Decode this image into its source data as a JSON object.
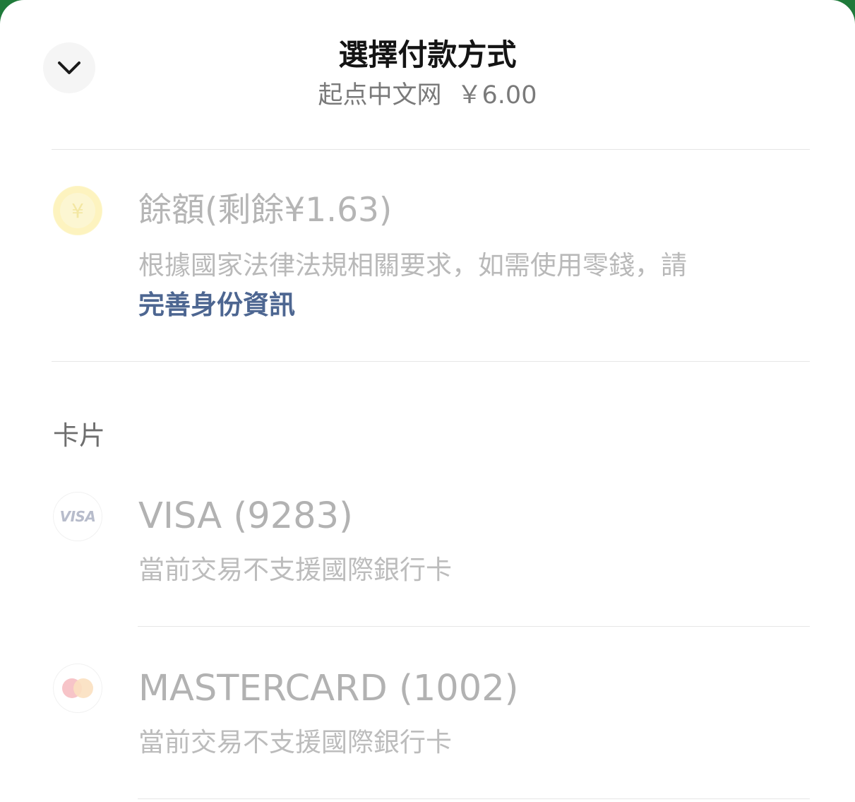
{
  "header": {
    "title": "選擇付款方式",
    "merchant": "起点中文网",
    "amount": "￥6.00",
    "collapse_icon": "chevron-down-icon"
  },
  "balance": {
    "icon": "yuan-coin-icon",
    "icon_glyph": "¥",
    "title": "餘額(剩餘¥1.63)",
    "desc_text": "根據國家法律法規相關要求，如需使用零錢，請 ",
    "desc_link": "完善身份資訊"
  },
  "cards": {
    "section_label": "卡片",
    "items": [
      {
        "icon": "visa-logo-icon",
        "logo_text": "VISA",
        "title": "VISA (9283)",
        "note": "當前交易不支援國際銀行卡"
      },
      {
        "icon": "mastercard-logo-icon",
        "title": "MASTERCARD (1002)",
        "note": "當前交易不支援國際銀行卡"
      }
    ]
  },
  "colors": {
    "background_frame": "#1f7a3a",
    "link": "#4d6691",
    "disabled_text": "#b5b5b5",
    "coin_fill": "#fdf6c9",
    "mastercard_red": "#f7c4c8",
    "mastercard_orange": "#fbe0c0"
  }
}
